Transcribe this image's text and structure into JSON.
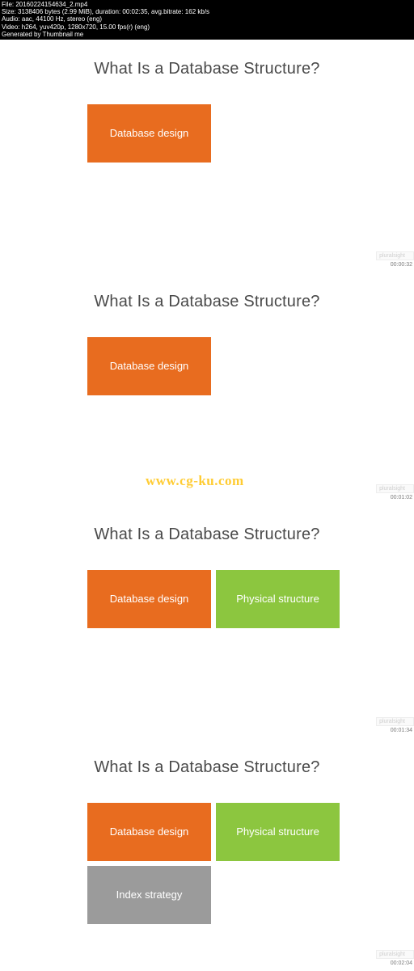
{
  "meta": {
    "line1": "File: 20160224154634_2.mp4",
    "line2": "Size: 3138406 bytes (2.99 MiB), duration: 00:02:35, avg.bitrate: 162 kb/s",
    "line3": "Audio: aac, 44100 Hz, stereo (eng)",
    "line4": "Video: h264, yuv420p, 1280x720, 15.00 fps(r) (eng)",
    "line5": "Generated by Thumbnail me"
  },
  "watermark": {
    "text": "www.cg-ku.com",
    "faint": "pluralsight"
  },
  "frames": [
    {
      "title": "What Is a Database Structure?",
      "row1": [
        {
          "label": "Database design",
          "color": "orange"
        }
      ],
      "row2": [],
      "timestamp": "00:00:32"
    },
    {
      "title": "What Is a Database Structure?",
      "row1": [
        {
          "label": "Database design",
          "color": "orange"
        }
      ],
      "row2": [],
      "timestamp": "00:01:02"
    },
    {
      "title": "What Is a Database Structure?",
      "row1": [
        {
          "label": "Database design",
          "color": "orange"
        },
        {
          "label": "Physical structure",
          "color": "green"
        }
      ],
      "row2": [],
      "timestamp": "00:01:34"
    },
    {
      "title": "What Is a Database Structure?",
      "row1": [
        {
          "label": "Database design",
          "color": "orange"
        },
        {
          "label": "Physical structure",
          "color": "green"
        }
      ],
      "row2": [
        {
          "label": "Index strategy",
          "color": "gray"
        }
      ],
      "timestamp": "00:02:04"
    }
  ]
}
